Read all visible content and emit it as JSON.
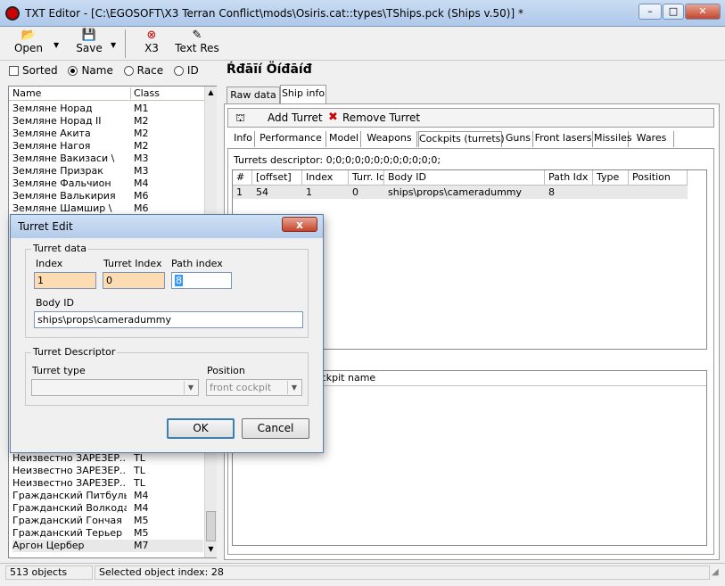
{
  "window": {
    "title": "TXT Editor - [C:\\EGOSOFT\\X3 Terran Conflict\\mods\\Osiris.cat::types\\TShips.pck (Ships v.50)] *"
  },
  "toolbar": {
    "open": "Open",
    "save": "Save",
    "x3": "X3",
    "textres": "Text Res"
  },
  "filters": {
    "sorted": "Sorted",
    "name": "Name",
    "race": "Race",
    "id": "ID"
  },
  "list": {
    "headers": {
      "name": "Name",
      "class": "Class"
    },
    "top_rows": [
      {
        "name": "Земляне Норад",
        "cls": "M1"
      },
      {
        "name": "Земляне Норад II",
        "cls": "M2"
      },
      {
        "name": "Земляне Акита",
        "cls": "M2"
      },
      {
        "name": "Земляне Нагоя",
        "cls": "M2"
      },
      {
        "name": "Земляне Вакизаси \\",
        "cls": "M3"
      },
      {
        "name": "Земляне Призрак",
        "cls": "M3"
      },
      {
        "name": "Земляне Фальчион",
        "cls": "M4"
      },
      {
        "name": "Земляне Валькирия",
        "cls": "M6"
      },
      {
        "name": "Земляне Шамшир \\",
        "cls": "M6"
      }
    ],
    "bottom_rows": [
      {
        "name": "Неизвестно ЗАРЕЗЕР...",
        "cls": "TL"
      },
      {
        "name": "Неизвестно ЗАРЕЗЕР...",
        "cls": "TL"
      },
      {
        "name": "Неизвестно ЗАРЕЗЕР...",
        "cls": "TL"
      },
      {
        "name": "Гражданский Питбуль",
        "cls": "M4"
      },
      {
        "name": "Гражданский Волкодав",
        "cls": "M4"
      },
      {
        "name": "Гражданский Гончая",
        "cls": "M5"
      },
      {
        "name": "Гражданский Терьер",
        "cls": "M5"
      },
      {
        "name": "Аргон Цербер",
        "cls": "M7"
      }
    ]
  },
  "ship_title": "Ŕđāīí Öíđāíđ",
  "main_tabs": {
    "raw": "Raw data",
    "info": "Ship info"
  },
  "turret_bar": {
    "add": "Add Turret",
    "remove": "Remove Turret"
  },
  "sub_tabs": [
    "Info",
    "Performance",
    "Model",
    "Weapons",
    "Cockpits (turrets)",
    "Guns",
    "Front lasers",
    "Missiles",
    "Wares"
  ],
  "descriptor": "Turrets descriptor: 0;0;0;0;0;0;0;0;0;0;0;0;",
  "grid": {
    "headers": [
      "#",
      "[offset]",
      "Index",
      "Turr. Idx",
      "Body ID",
      "Path Idx",
      "Type",
      "Position"
    ],
    "row": [
      "1",
      "54",
      "1",
      "0",
      "ships\\props\\cameradummy",
      "8",
      "",
      ""
    ]
  },
  "grid2_header": "ockpit name",
  "status": {
    "count": "513 objects",
    "selected": "Selected object index: 28"
  },
  "dialog": {
    "title": "Turret Edit",
    "close": "x",
    "group1": "Turret data",
    "index_label": "Index",
    "index_value": "1",
    "turret_index_label": "Turret Index",
    "turret_index_value": "0",
    "path_index_label": "Path index",
    "path_index_value": "8",
    "body_label": "Body ID",
    "body_value": "ships\\props\\cameradummy",
    "group2": "Turret Descriptor",
    "type_label": "Turret type",
    "type_value": "",
    "position_label": "Position",
    "position_value": "front cockpit",
    "ok": "OK",
    "cancel": "Cancel"
  }
}
